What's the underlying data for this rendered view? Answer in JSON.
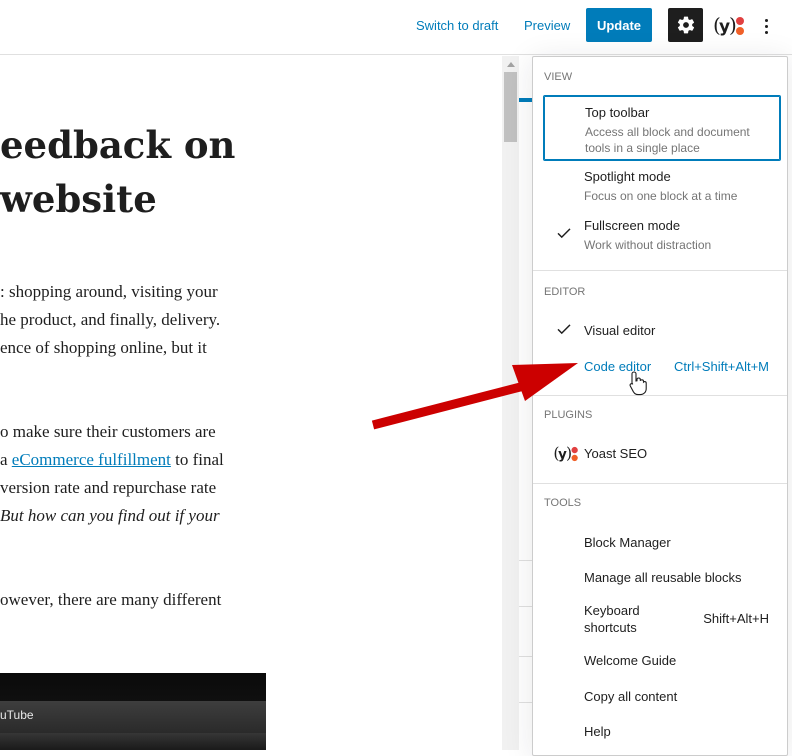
{
  "topbar": {
    "switch_to_draft": "Switch to draft",
    "preview": "Preview",
    "update": "Update",
    "settings_icon": "gear-icon",
    "yoast_icon": "yoast-icon",
    "more_icon": "more-vertical-icon"
  },
  "post": {
    "title": "eedback on\nwebsite",
    "paragraphs": [
      {
        "line1": ": shopping around, visiting your",
        "line2": "he product, and finally, delivery.",
        "line3": "ence of shopping online, but it"
      },
      {
        "line1": "o make sure their customers are",
        "line2_pre": "a ",
        "line2_link": "eCommerce fulfillment",
        "line2_post": " to final",
        "line3": "version rate and repurchase rate",
        "line4": " But how can you find out if your"
      },
      {
        "line1": "owever, there are many different"
      }
    ],
    "video_label": "uTube"
  },
  "menu": {
    "view": {
      "title": "View",
      "items": [
        {
          "label": "Top toolbar",
          "desc": "Access all block and document tools in a single place"
        },
        {
          "label": "Spotlight mode",
          "desc": "Focus on one block at a time"
        },
        {
          "label": "Fullscreen mode",
          "desc": "Work without distraction",
          "checked": true
        }
      ]
    },
    "editor": {
      "title": "Editor",
      "items": [
        {
          "label": "Visual editor",
          "checked": true
        },
        {
          "label": "Code editor",
          "shortcut": "Ctrl+Shift+Alt+M"
        }
      ]
    },
    "plugins": {
      "title": "Plugins",
      "items": [
        {
          "label": "Yoast SEO",
          "icon": "yoast-icon"
        }
      ]
    },
    "tools": {
      "title": "Tools",
      "items": [
        {
          "label": "Block Manager"
        },
        {
          "label": "Manage all reusable blocks"
        },
        {
          "label": "Keyboard shortcuts",
          "shortcut": "Shift+Alt+H"
        },
        {
          "label": "Welcome Guide"
        },
        {
          "label": "Copy all content"
        },
        {
          "label": "Help"
        }
      ]
    }
  },
  "colors": {
    "accent": "#007cba",
    "arrow": "#cc0000",
    "yoast_orange": "#f06028",
    "yoast_red": "#e14040"
  }
}
